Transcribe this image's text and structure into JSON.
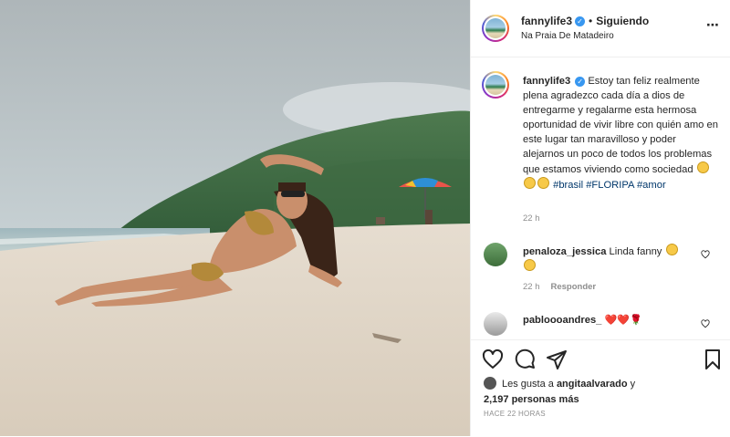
{
  "post": {
    "username": "fannylife3",
    "verified_mark": "✓",
    "separator": "•",
    "follow_status": "Siguiendo",
    "location": "Na Praia De Matadeiro",
    "more_icon": "⋯"
  },
  "caption": {
    "username": "fannylife3",
    "text": "Estoy tan feliz realmente plena agradezco cada día a dios de entregarme y regalarme esta hermosa oportunidad de vivir libre con quién amo en este lugar tan maravilloso y poder alejarnos un poco de todos los problemas que estamos viviendo como sociedad",
    "emojis": [
      "😔",
      "😊",
      "😊"
    ],
    "hashtags": [
      "#brasil",
      "#FLORIPA",
      "#amor"
    ],
    "time": "22 h"
  },
  "comments": [
    {
      "username": "penaloza_jessica",
      "text": "Linda fanny",
      "emojis": [
        "😘",
        "😘"
      ],
      "time": "22 h",
      "reply_label": "Responder"
    },
    {
      "username": "pabloooandres_",
      "text": "",
      "emojis": [
        "❤️",
        "❤️",
        "🌹"
      ]
    }
  ],
  "actions": {
    "like_icon": "heart-outline",
    "comment_icon": "speech-bubble",
    "share_icon": "paper-plane",
    "save_icon": "bookmark"
  },
  "likes": {
    "prefix": "Les gusta a",
    "user": "angitaalvarado",
    "connector": "y",
    "count": "2,197 personas más"
  },
  "timestamp": "HACE 22 HORAS",
  "colors": {
    "link": "#00376b",
    "verified": "#3897f0",
    "border": "#efefef",
    "muted": "#8e8e8e"
  }
}
